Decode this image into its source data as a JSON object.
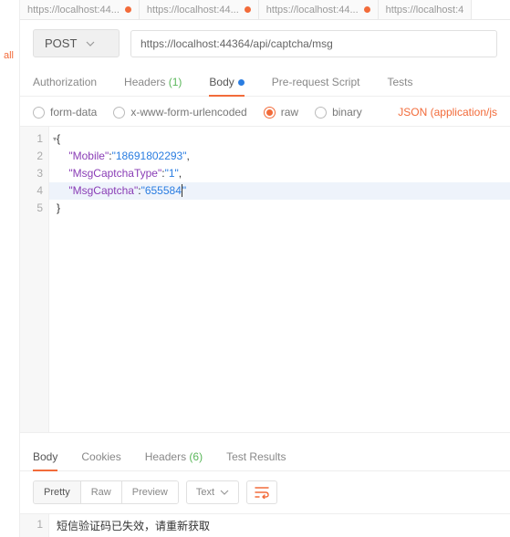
{
  "sidebar": {
    "all_label": "all"
  },
  "tabs": [
    {
      "label": "https://localhost:44...",
      "modified": true
    },
    {
      "label": "https://localhost:44...",
      "modified": true
    },
    {
      "label": "https://localhost:44...",
      "modified": true
    },
    {
      "label": "https://localhost:4",
      "modified": false
    }
  ],
  "request": {
    "method": "POST",
    "url": "https://localhost:44364/api/captcha/msg"
  },
  "request_tabs": {
    "authorization": "Authorization",
    "headers": "Headers",
    "headers_count": "(1)",
    "body": "Body",
    "prerequest": "Pre-request Script",
    "tests": "Tests"
  },
  "body_options": {
    "form_data": "form-data",
    "urlencoded": "x-www-form-urlencoded",
    "raw": "raw",
    "binary": "binary",
    "content_type": "JSON (application/js"
  },
  "editor_lines": [
    "1",
    "2",
    "3",
    "4",
    "5"
  ],
  "request_body": {
    "open": "{",
    "k1": "\"Mobile\"",
    "c1": ":",
    "v1": "\"18691802293\"",
    "t1": ",",
    "k2": "\"MsgCaptchaType\"",
    "c2": ":",
    "v2": "\"1\"",
    "t2": ",",
    "k3": "\"MsgCaptcha\"",
    "c3": ":",
    "v3a": "\"655584",
    "v3b": "\"",
    "close": "}"
  },
  "response_tabs": {
    "body": "Body",
    "cookies": "Cookies",
    "headers": "Headers",
    "headers_count": "(6)",
    "test_results": "Test Results"
  },
  "response_view": {
    "pretty": "Pretty",
    "raw": "Raw",
    "preview": "Preview",
    "format": "Text"
  },
  "response_line_no": "1",
  "response_text": "短信验证码已失效，请重新获取"
}
